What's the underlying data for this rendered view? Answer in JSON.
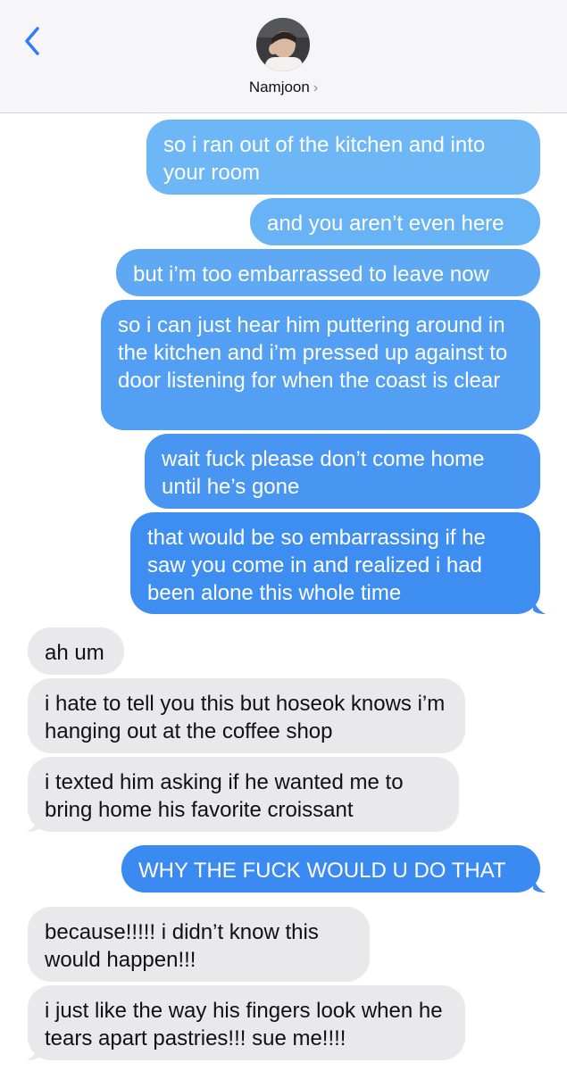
{
  "header": {
    "contact_name": "Namjoon",
    "chevron": "›"
  },
  "icons": {
    "back": "chevron-left-icon",
    "details": "chevron-right-icon"
  },
  "colors": {
    "outgoing_top": "#6cb6f6",
    "outgoing_bottom": "#3b87f0",
    "incoming": "#e9e9eb",
    "accent": "#2f7cf6"
  },
  "messages": [
    {
      "from": "me",
      "text": "so i ran out of the kitchen and into your room"
    },
    {
      "from": "me",
      "text": "and you aren’t even here"
    },
    {
      "from": "me",
      "text": "but i’m too embarrassed to leave now"
    },
    {
      "from": "me",
      "text": "so i can just hear him puttering around in the kitchen and i’m pressed up against to door listening for when the coast is clear"
    },
    {
      "from": "me",
      "text": "wait fuck please don’t come home until he’s gone"
    },
    {
      "from": "me",
      "text": "that would be so embarrassing if he saw you come in and realized i had been alone this whole time"
    },
    {
      "from": "them",
      "text": "ah um"
    },
    {
      "from": "them",
      "text": "i hate to tell you this but hoseok knows i’m hanging out at the coffee shop"
    },
    {
      "from": "them",
      "text": "i texted him asking if he wanted me to bring home his favorite croissant"
    },
    {
      "from": "me",
      "text": "WHY THE FUCK WOULD U DO THAT"
    },
    {
      "from": "them",
      "text": "because!!!!! i didn’t know this would happen!!!"
    },
    {
      "from": "them",
      "text": "i just like the way his fingers look when he tears apart pastries!!! sue me!!!!"
    }
  ]
}
